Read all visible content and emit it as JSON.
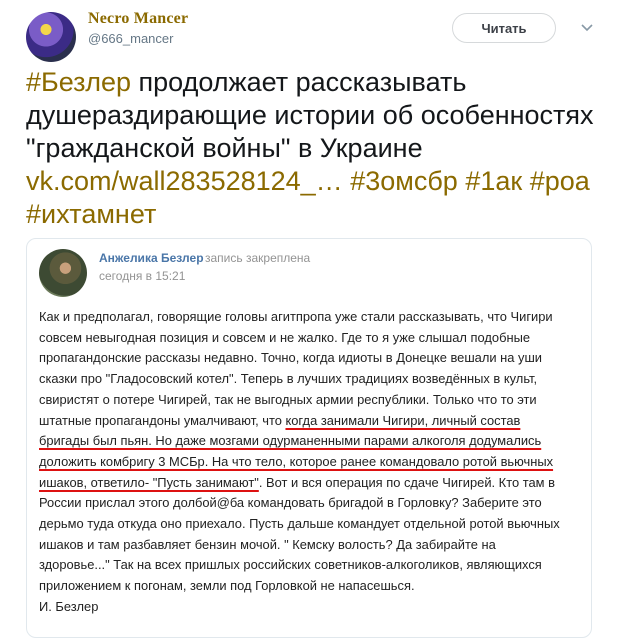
{
  "author": {
    "name": "Necro Mancer",
    "handle": "@666_mancer",
    "follow_label": "Читать"
  },
  "tweet": {
    "t1": "#Безлер",
    "t2": " продолжает рассказывать душераздирающие истории об особенностях \"гражданской войны\" в Украине ",
    "link": "vk.com/wall283528124_…",
    "h1": "#3омсбр",
    "h2": "#1ак",
    "h3": "#роа",
    "h4": "#ихтамнет"
  },
  "vk_post": {
    "author": "Анжелика Безлер",
    "pinned": "запись закреплена",
    "time": "сегодня в 15:21",
    "p1": "Как и предполагал, говорящие головы агитпропа уже стали рассказывать, что Чигири совсем невыгодная позиция и совсем и не жалко. Где то я уже слышал подобные пропагандонские рассказы недавно. Точно, когда идиоты в Донецке вешали на уши сказки про \"Гладосовский котел\". Теперь в лучших традициях возведённых в культ, свиристят о потере Чигирей, так не выгодных армии республики. Только что то эти штатные пропагандоны умалчивают, что ",
    "u1": "когда занимали Чигири, личный состав бригады был пьян. Но даже мозгами одурманенными парами алкоголя додумались доложить комбригу 3 МСБр. На что тело, которое ранее командовало ротой вьючных ишаков, ответило- \"Пусть занимают\"",
    "p2": ". Вот и вся операция по сдаче Чигирей. Кто там в России прислал этого долбой@ба командовать бригадой в Горловку? Заберите это дерьмо туда откуда оно приехало. Пусть дальше командует отдельной ротой вьючных ишаков и там разбавляет бензин мочой. \" Кемску волость? Да забирайте на здоровье...\" Так на всех пришлых российских советников-алкоголиков, являющихся приложением к погонам, земли под Горловкой не напасешься.",
    "sign": "И. Безлер"
  }
}
